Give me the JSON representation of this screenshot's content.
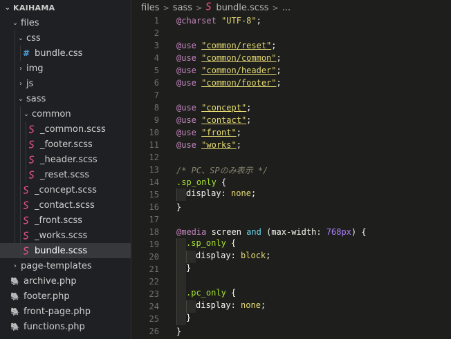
{
  "sidebar": {
    "header": "KAIHAMA",
    "tree": [
      {
        "label": "files",
        "depth": 0,
        "kind": "folder",
        "open": true
      },
      {
        "label": "css",
        "depth": 1,
        "kind": "folder",
        "open": true
      },
      {
        "label": "bundle.css",
        "depth": 2,
        "kind": "css"
      },
      {
        "label": "img",
        "depth": 1,
        "kind": "folder",
        "open": false
      },
      {
        "label": "js",
        "depth": 1,
        "kind": "folder",
        "open": false
      },
      {
        "label": "sass",
        "depth": 1,
        "kind": "folder",
        "open": true
      },
      {
        "label": "common",
        "depth": 2,
        "kind": "folder",
        "open": true
      },
      {
        "label": "_common.scss",
        "depth": 3,
        "kind": "scss"
      },
      {
        "label": "_footer.scss",
        "depth": 3,
        "kind": "scss"
      },
      {
        "label": "_header.scss",
        "depth": 3,
        "kind": "scss"
      },
      {
        "label": "_reset.scss",
        "depth": 3,
        "kind": "scss"
      },
      {
        "label": "_concept.scss",
        "depth": 2,
        "kind": "scss"
      },
      {
        "label": "_contact.scss",
        "depth": 2,
        "kind": "scss"
      },
      {
        "label": "_front.scss",
        "depth": 2,
        "kind": "scss"
      },
      {
        "label": "_works.scss",
        "depth": 2,
        "kind": "scss"
      },
      {
        "label": "bundle.scss",
        "depth": 2,
        "kind": "scss",
        "selected": true
      },
      {
        "label": "page-templates",
        "depth": 0,
        "kind": "folder",
        "open": false
      },
      {
        "label": "archive.php",
        "depth": 0,
        "kind": "php"
      },
      {
        "label": "footer.php",
        "depth": 0,
        "kind": "php"
      },
      {
        "label": "front-page.php",
        "depth": 0,
        "kind": "php"
      },
      {
        "label": "functions.php",
        "depth": 0,
        "kind": "php"
      }
    ]
  },
  "breadcrumb": {
    "parts": [
      "files",
      "sass",
      "bundle.scss",
      "..."
    ]
  },
  "colors": {
    "at_rule": "#c586c0",
    "string": "#e6db74",
    "comment": "#88846f",
    "selector": "#a6e22e",
    "keyword": "#66d9ef",
    "number": "#ae81ff",
    "scss_icon": "#e0527d",
    "php_icon": "#a074c4",
    "css_icon": "#4c9ed9"
  },
  "editor": {
    "lines": [
      {
        "n": "1",
        "indent": 0,
        "tokens": [
          [
            "at",
            "@charset"
          ],
          [
            "plain",
            " "
          ],
          [
            "str",
            "\"UTF-8\""
          ],
          [
            "plain",
            ";"
          ]
        ]
      },
      {
        "n": "2",
        "indent": 0,
        "tokens": []
      },
      {
        "n": "3",
        "indent": 0,
        "tokens": [
          [
            "at",
            "@use"
          ],
          [
            "plain",
            " "
          ],
          [
            "stru",
            "\"common/reset\""
          ],
          [
            "plain",
            ";"
          ]
        ]
      },
      {
        "n": "4",
        "indent": 0,
        "tokens": [
          [
            "at",
            "@use"
          ],
          [
            "plain",
            " "
          ],
          [
            "stru",
            "\"common/common\""
          ],
          [
            "plain",
            ";"
          ]
        ]
      },
      {
        "n": "5",
        "indent": 0,
        "tokens": [
          [
            "at",
            "@use"
          ],
          [
            "plain",
            " "
          ],
          [
            "stru",
            "\"common/header\""
          ],
          [
            "plain",
            ";"
          ]
        ]
      },
      {
        "n": "6",
        "indent": 0,
        "tokens": [
          [
            "at",
            "@use"
          ],
          [
            "plain",
            " "
          ],
          [
            "stru",
            "\"common/footer\""
          ],
          [
            "plain",
            ";"
          ]
        ]
      },
      {
        "n": "7",
        "indent": 0,
        "tokens": []
      },
      {
        "n": "8",
        "indent": 0,
        "tokens": [
          [
            "at",
            "@use"
          ],
          [
            "plain",
            " "
          ],
          [
            "stru",
            "\"concept\""
          ],
          [
            "plain",
            ";"
          ]
        ]
      },
      {
        "n": "9",
        "indent": 0,
        "tokens": [
          [
            "at",
            "@use"
          ],
          [
            "plain",
            " "
          ],
          [
            "stru",
            "\"contact\""
          ],
          [
            "plain",
            ";"
          ]
        ]
      },
      {
        "n": "10",
        "indent": 0,
        "tokens": [
          [
            "at",
            "@use"
          ],
          [
            "plain",
            " "
          ],
          [
            "stru",
            "\"front\""
          ],
          [
            "plain",
            ";"
          ]
        ]
      },
      {
        "n": "11",
        "indent": 0,
        "tokens": [
          [
            "at",
            "@use"
          ],
          [
            "plain",
            " "
          ],
          [
            "stru",
            "\"works\""
          ],
          [
            "plain",
            ";"
          ]
        ]
      },
      {
        "n": "12",
        "indent": 0,
        "tokens": []
      },
      {
        "n": "13",
        "indent": 0,
        "tokens": [
          [
            "cmt",
            "/* PC、SPのみ表示 */"
          ]
        ]
      },
      {
        "n": "14",
        "indent": 0,
        "tokens": [
          [
            "sel",
            ".sp_only"
          ],
          [
            "plain",
            " {"
          ]
        ]
      },
      {
        "n": "15",
        "indent": 1,
        "tokens": [
          [
            "prop",
            "display"
          ],
          [
            "plain",
            ": "
          ],
          [
            "val",
            "none"
          ],
          [
            "plain",
            ";"
          ]
        ]
      },
      {
        "n": "16",
        "indent": 0,
        "tokens": [
          [
            "plain",
            "}"
          ]
        ]
      },
      {
        "n": "17",
        "indent": 0,
        "tokens": []
      },
      {
        "n": "18",
        "indent": 0,
        "tokens": [
          [
            "at",
            "@media"
          ],
          [
            "plain",
            " screen "
          ],
          [
            "kw",
            "and"
          ],
          [
            "plain",
            " (max-width: "
          ],
          [
            "num",
            "768px"
          ],
          [
            "plain",
            ") {"
          ]
        ]
      },
      {
        "n": "19",
        "indent": 1,
        "tokens": [
          [
            "sel",
            ".sp_only"
          ],
          [
            "plain",
            " {"
          ]
        ]
      },
      {
        "n": "20",
        "indent": 2,
        "tokens": [
          [
            "prop",
            "display"
          ],
          [
            "plain",
            ": "
          ],
          [
            "val",
            "block"
          ],
          [
            "plain",
            ";"
          ]
        ]
      },
      {
        "n": "21",
        "indent": 1,
        "tokens": [
          [
            "plain",
            "}"
          ]
        ]
      },
      {
        "n": "22",
        "indent": 1,
        "tokens": []
      },
      {
        "n": "23",
        "indent": 1,
        "tokens": [
          [
            "sel",
            ".pc_only"
          ],
          [
            "plain",
            " {"
          ]
        ]
      },
      {
        "n": "24",
        "indent": 2,
        "tokens": [
          [
            "prop",
            "display"
          ],
          [
            "plain",
            ": "
          ],
          [
            "val",
            "none"
          ],
          [
            "plain",
            ";"
          ]
        ]
      },
      {
        "n": "25",
        "indent": 1,
        "tokens": [
          [
            "plain",
            "}"
          ]
        ]
      },
      {
        "n": "26",
        "indent": 0,
        "tokens": [
          [
            "plain",
            "}"
          ]
        ]
      }
    ]
  }
}
